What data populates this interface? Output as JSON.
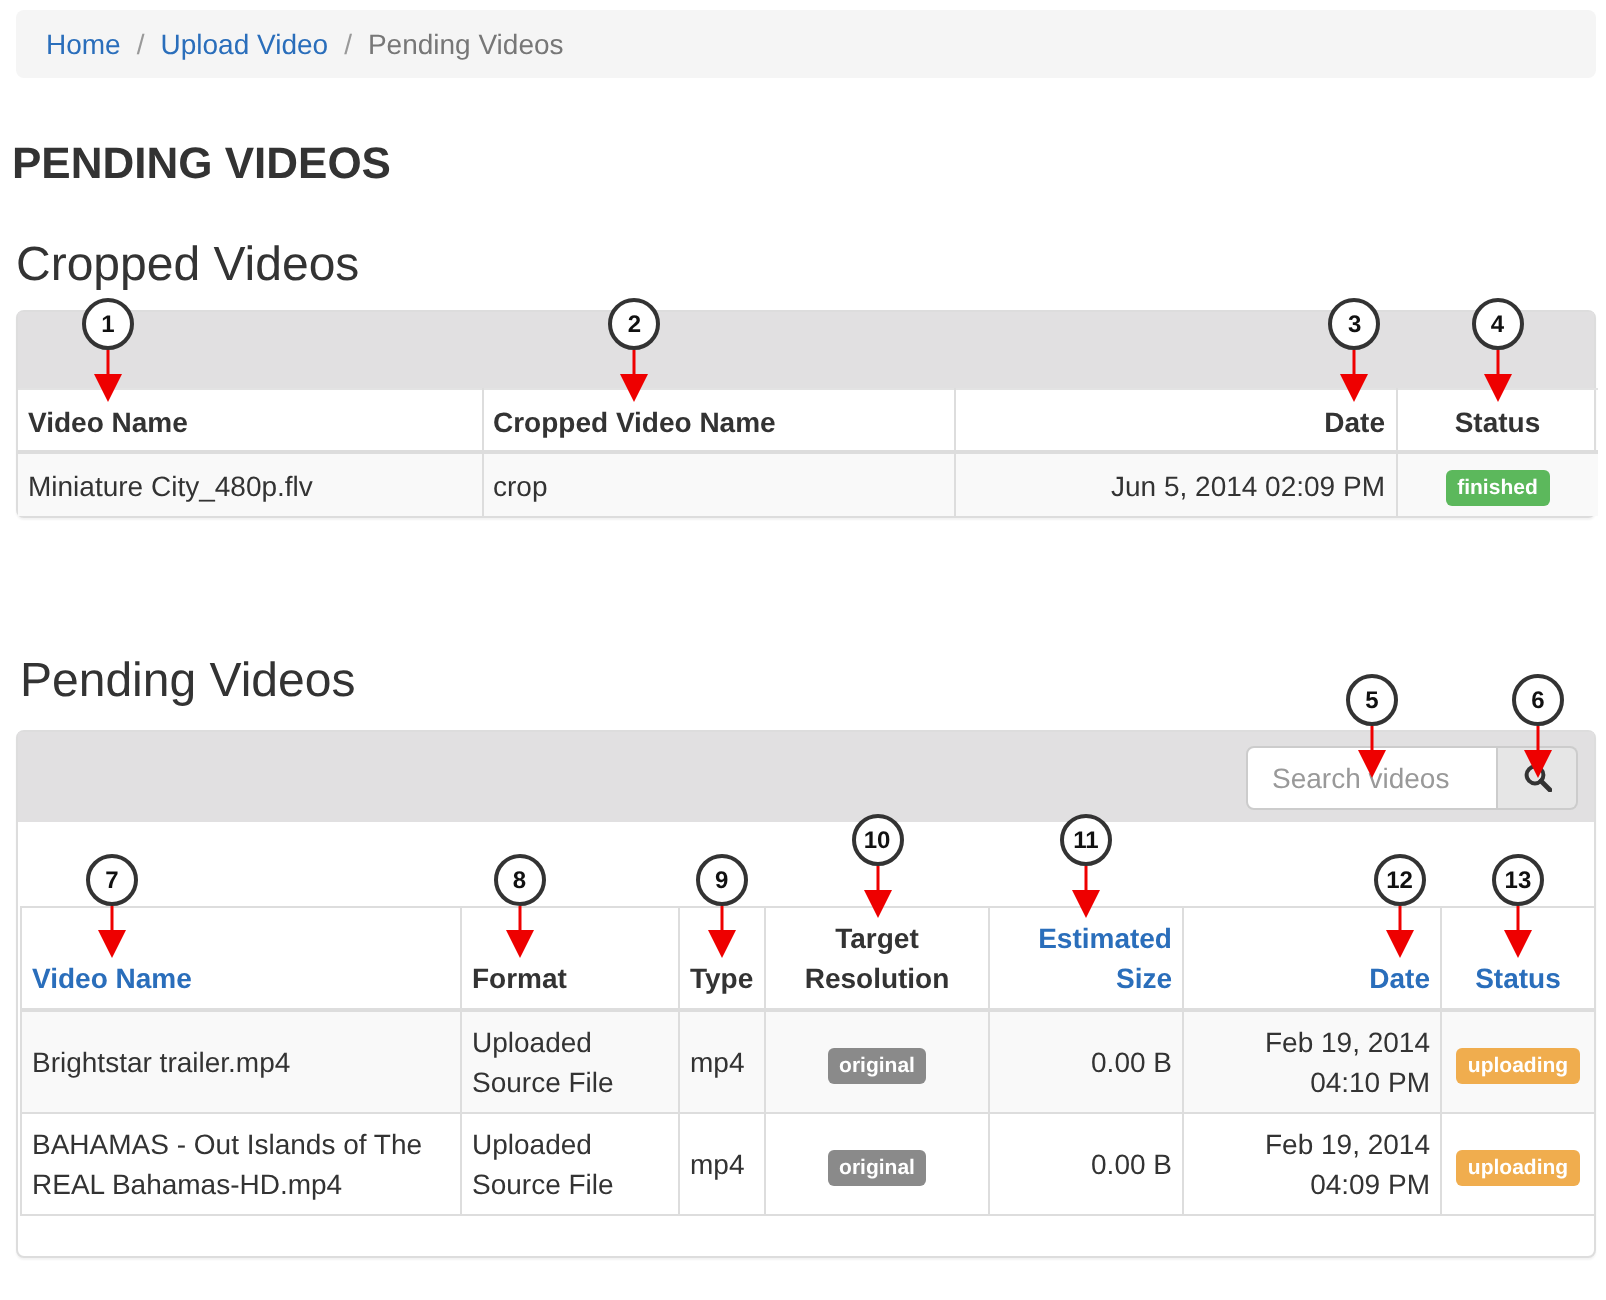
{
  "breadcrumb": [
    {
      "label": "Home",
      "link": true
    },
    {
      "separator": "/"
    },
    {
      "label": "Upload Video",
      "link": true
    },
    {
      "separator": "/"
    },
    {
      "label": "Pending Videos",
      "link": false
    }
  ],
  "page_title": "PENDING VIDEOS",
  "cropped": {
    "title": "Cropped Videos",
    "columns": [
      {
        "label": "Video Name",
        "kind": "text",
        "sortable": false,
        "callout": "1"
      },
      {
        "label": "Cropped Video Name",
        "kind": "text",
        "sortable": false,
        "callout": "2"
      },
      {
        "label": "Date",
        "kind": "date",
        "sortable": false,
        "callout": "3"
      },
      {
        "label": "Status",
        "kind": "status",
        "sortable": false,
        "callout": "4"
      }
    ],
    "rows": [
      {
        "cells": [
          "Miniature City_480p.flv",
          "crop",
          "Jun 5, 2014 02:09 PM",
          "finished"
        ],
        "color": "#5cb85c"
      }
    ]
  },
  "pending": {
    "title": "Pending Videos",
    "search": {
      "placeholder": "Search videos",
      "callout": "5",
      "button_callout": "6"
    },
    "columns": [
      {
        "label": "Video Name",
        "kind": "text",
        "sortable": true,
        "callout": "7"
      },
      {
        "label": "Format",
        "kind": "text",
        "sortable": false,
        "callout": "8"
      },
      {
        "label": "Type",
        "kind": "text",
        "sortable": false,
        "callout": "9"
      },
      {
        "label": "Target Resolution",
        "kind": "badge",
        "sortable": false,
        "callout": "10"
      },
      {
        "label": "Estimated Size",
        "kind": "size",
        "sortable": true,
        "callout": "11"
      },
      {
        "label": "Date",
        "kind": "date",
        "sortable": true,
        "callout": "12"
      },
      {
        "label": "Status",
        "kind": "status",
        "sortable": true,
        "callout": "13"
      }
    ],
    "rows": [
      {
        "cells": [
          "Brightstar trailer.mp4",
          "Uploaded Source File",
          "mp4",
          "original",
          "0.00 B",
          "Feb 19, 2014 04:10 PM",
          "uploading"
        ],
        "color": "#f0ad4e"
      },
      {
        "cells": [
          "BAHAMAS - Out Islands of The REAL Bahamas-HD.mp4",
          "Uploaded Source File",
          "mp4",
          "original",
          "0.00 B",
          "Feb 19, 2014 04:09 PM",
          "uploading"
        ],
        "color": "#f0ad4e"
      }
    ]
  }
}
